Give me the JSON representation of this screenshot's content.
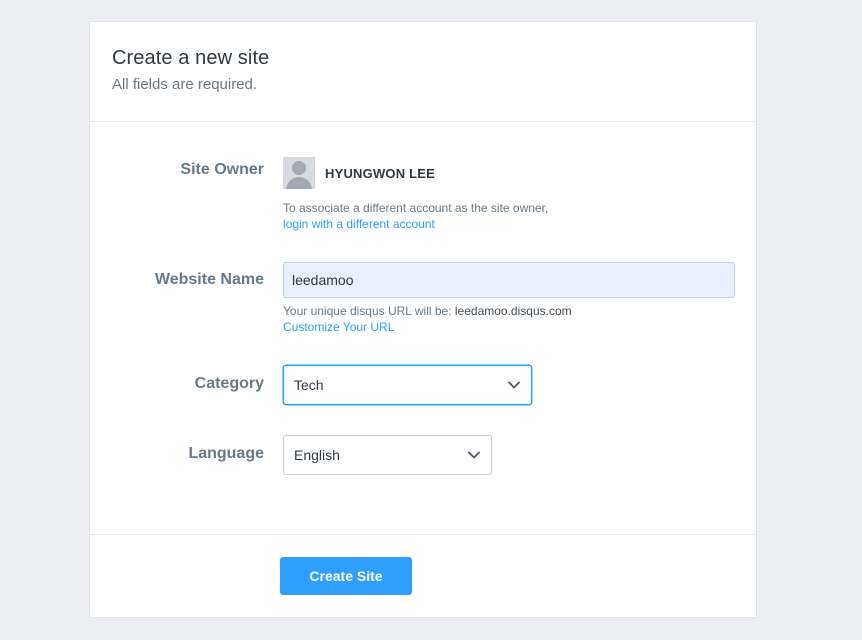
{
  "header": {
    "title": "Create a new site",
    "subtitle": "All fields are required."
  },
  "owner": {
    "label": "Site Owner",
    "name": "HYUNGWON LEE",
    "help_text": "To associate a different account as the site owner,",
    "help_link": "login with a different account"
  },
  "website": {
    "label": "Website Name",
    "value": "leedamoo",
    "help_prefix": "Your unique disqus URL will be:",
    "help_url": "leedamoo.disqus.com",
    "help_link": "Customize Your URL"
  },
  "category": {
    "label": "Category",
    "selected": "Tech"
  },
  "language": {
    "label": "Language",
    "selected": "English"
  },
  "footer": {
    "create_label": "Create Site"
  },
  "colors": {
    "accent": "#2e9fff",
    "input_fill": "#e8f0fe"
  },
  "icons": {
    "avatar": "default-avatar-icon",
    "dropdown": "chevron-down-icon"
  }
}
